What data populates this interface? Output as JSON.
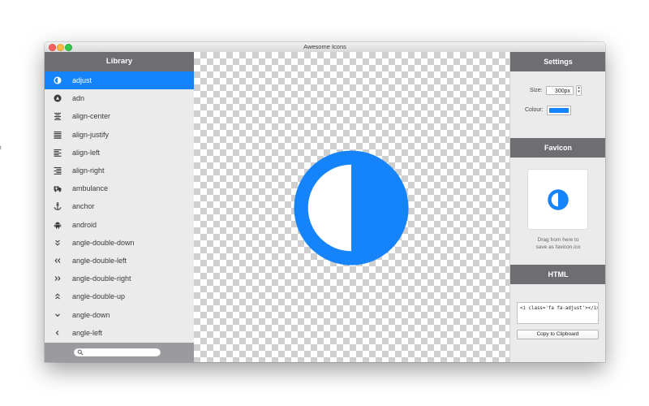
{
  "stray_text": "t",
  "window": {
    "title": "Awesome Icons"
  },
  "sidebar": {
    "header": "Library",
    "items": [
      {
        "label": "adjust",
        "icon": "adjust-icon",
        "selected": true
      },
      {
        "label": "adn",
        "icon": "adn-icon"
      },
      {
        "label": "align-center",
        "icon": "align-center-icon"
      },
      {
        "label": "align-justify",
        "icon": "align-justify-icon"
      },
      {
        "label": "align-left",
        "icon": "align-left-icon"
      },
      {
        "label": "align-right",
        "icon": "align-right-icon"
      },
      {
        "label": "ambulance",
        "icon": "ambulance-icon"
      },
      {
        "label": "anchor",
        "icon": "anchor-icon"
      },
      {
        "label": "android",
        "icon": "android-icon"
      },
      {
        "label": "angle-double-down",
        "icon": "angle-double-down-icon"
      },
      {
        "label": "angle-double-left",
        "icon": "angle-double-left-icon"
      },
      {
        "label": "angle-double-right",
        "icon": "angle-double-right-icon"
      },
      {
        "label": "angle-double-up",
        "icon": "angle-double-up-icon"
      },
      {
        "label": "angle-down",
        "icon": "angle-down-icon"
      },
      {
        "label": "angle-left",
        "icon": "angle-left-icon"
      }
    ],
    "search_placeholder": ""
  },
  "settings": {
    "header": "Settings",
    "size_label": "Size:",
    "size_value": "300px",
    "colour_label": "Colour:",
    "colour": "#1584fb"
  },
  "favicon": {
    "header": "Favicon",
    "hint_line1": "Drag from here to",
    "hint_line2": "save as favicon.ico"
  },
  "html": {
    "header": "HTML",
    "code": "<i class='fa fa-adjust'></i>",
    "copy_button": "Copy to Clipboard"
  },
  "colors": {
    "accent": "#1584fb",
    "header": "#6e6e72"
  }
}
